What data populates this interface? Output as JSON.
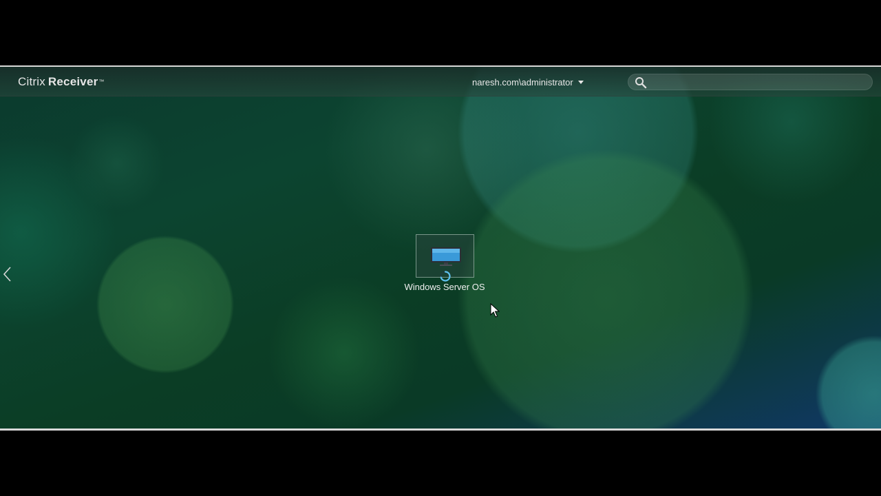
{
  "header": {
    "logo_light": "Citrix",
    "logo_bold": "Receiver",
    "logo_tm": "™",
    "user_label": "naresh.com\\administrator",
    "search_placeholder": ""
  },
  "apps": [
    {
      "label": "Windows Server OS",
      "icon": "desktop-monitor-icon",
      "status": "launching"
    }
  ],
  "navigation": {
    "prev_icon": "chevron-left-icon"
  },
  "colors": {
    "text": "#e8e8e8",
    "background_dark": "#0b3a2e",
    "background_blue": "#103866",
    "monitor_screen": "#3a9ad9"
  }
}
